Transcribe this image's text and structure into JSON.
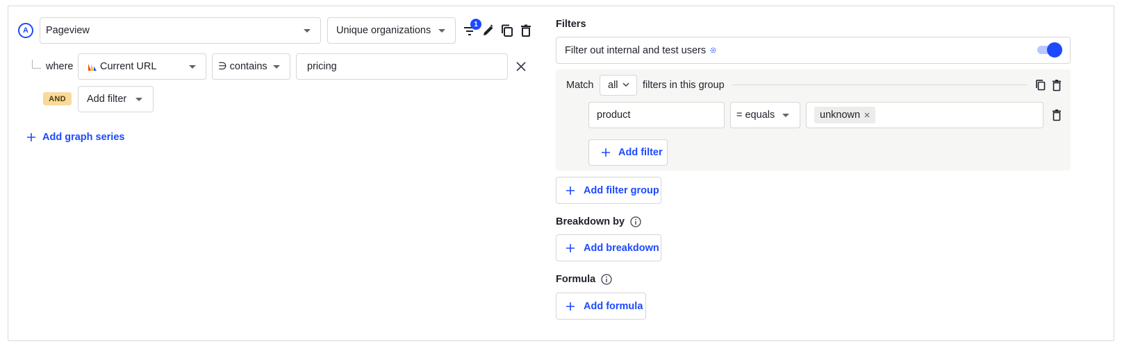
{
  "series": {
    "letter": "A",
    "event": "Pageview",
    "aggregation": "Unique organizations",
    "filter_count": "1"
  },
  "property_filter": {
    "where_label": "where",
    "property": "Current URL",
    "operator": "∋ contains",
    "value": "pricing"
  },
  "and_label": "AND",
  "add_filter_label": "Add filter",
  "add_graph_series_label": "Add graph series",
  "filters": {
    "heading": "Filters",
    "internal_toggle_label": "Filter out internal and test users",
    "internal_toggle_on": true,
    "group": {
      "match_label": "Match",
      "match_value": "all",
      "match_suffix": "filters in this group",
      "property": "product",
      "operator": "= equals",
      "value_chip": "unknown",
      "add_filter_label": "Add filter"
    },
    "add_filter_group_label": "Add filter group"
  },
  "breakdown": {
    "heading": "Breakdown by",
    "add_label": "Add breakdown"
  },
  "formula": {
    "heading": "Formula",
    "add_label": "Add formula"
  },
  "colors": {
    "accent": "#1d4aff",
    "and_tag": "#f9da9b"
  }
}
